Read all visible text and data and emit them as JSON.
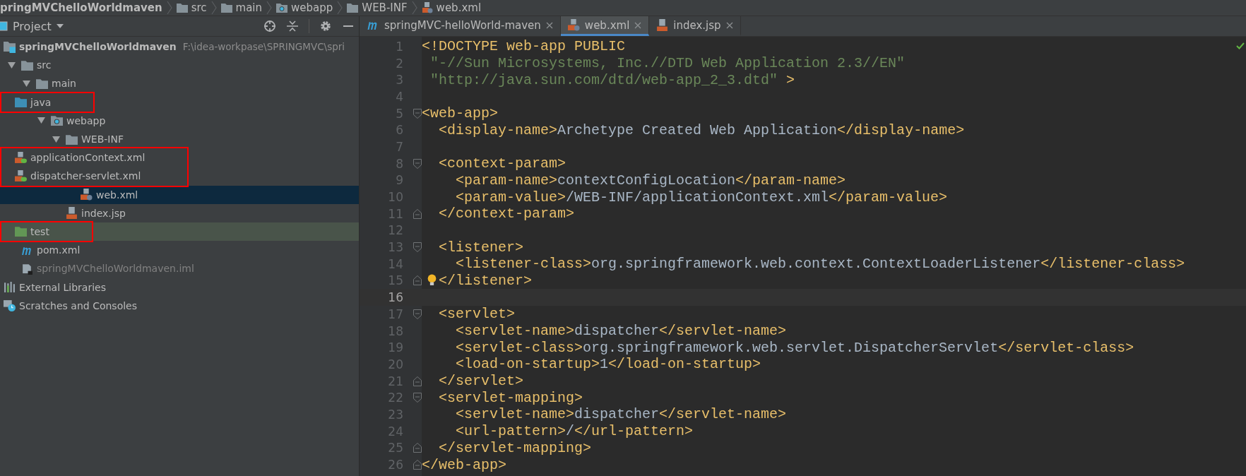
{
  "breadcrumb": [
    {
      "label": "pringMVChelloWorldmaven",
      "kind": "module"
    },
    {
      "label": "src",
      "kind": "folder"
    },
    {
      "label": "main",
      "kind": "folder"
    },
    {
      "label": "webapp",
      "kind": "web-folder"
    },
    {
      "label": "WEB-INF",
      "kind": "folder"
    },
    {
      "label": "web.xml",
      "kind": "web-xml"
    }
  ],
  "project_panel": {
    "title": "Project",
    "tree": [
      {
        "label": "springMVChelloWorldmaven",
        "path": "F:\\idea-workpase\\SPRINGMVC\\spri",
        "kind": "module",
        "selected": false,
        "children": [
          {
            "label": "src",
            "kind": "folder",
            "expanded": true,
            "selected": false,
            "children": [
              {
                "label": "main",
                "kind": "folder",
                "expanded": true,
                "selected": false,
                "children": [
                  {
                    "label": "java",
                    "kind": "source-folder",
                    "selected": false,
                    "marked": true
                  },
                  {
                    "label": "webapp",
                    "kind": "web-folder",
                    "expanded": true,
                    "selected": false,
                    "children": [
                      {
                        "label": "WEB-INF",
                        "kind": "folder",
                        "expanded": true,
                        "selected": false,
                        "children": [
                          {
                            "label": "applicationContext.xml",
                            "kind": "spring-xml",
                            "selected": false,
                            "marked": true
                          },
                          {
                            "label": "dispatcher-servlet.xml",
                            "kind": "spring-xml",
                            "selected": false,
                            "marked": true
                          },
                          {
                            "label": "web.xml",
                            "kind": "web-xml",
                            "selected": true
                          }
                        ]
                      },
                      {
                        "label": "index.jsp",
                        "kind": "jsp",
                        "selected": false
                      }
                    ]
                  }
                ]
              },
              {
                "label": "test",
                "kind": "test-folder",
                "selected": false,
                "tinted": true,
                "marked": true
              }
            ]
          },
          {
            "label": "pom.xml",
            "kind": "maven",
            "selected": false
          },
          {
            "label": "springMVChelloWorldmaven.iml",
            "kind": "iml",
            "dim": true,
            "selected": false
          }
        ]
      },
      {
        "label": "External Libraries",
        "kind": "libraries",
        "selected": false
      },
      {
        "label": "Scratches and Consoles",
        "kind": "scratches",
        "selected": false
      }
    ]
  },
  "editor": {
    "tabs": [
      {
        "label": "springMVC-helloWorld-maven",
        "kind": "maven",
        "selected": false
      },
      {
        "label": "web.xml",
        "kind": "web-xml",
        "selected": true
      },
      {
        "label": "index.jsp",
        "kind": "jsp",
        "selected": false
      }
    ],
    "lines": [
      {
        "number": "1",
        "tokens": [
          {
            "kind": "tag",
            "text": "<!DOCTYPE web-app PUBLIC"
          }
        ]
      },
      {
        "number": "2",
        "tokens": [
          {
            "kind": "string",
            "text": " \"-//Sun Microsystems, Inc.//DTD Web Application 2.3//EN\""
          }
        ]
      },
      {
        "number": "3",
        "tokens": [
          {
            "kind": "string",
            "text": " \"http://java.sun.com/dtd/web-app_2_3.dtd\""
          },
          {
            "kind": "tag",
            "text": " >"
          }
        ]
      },
      {
        "number": "4"
      },
      {
        "number": "5",
        "fold_open": true,
        "tokens": [
          {
            "kind": "tag",
            "text": "<web-app>"
          }
        ]
      },
      {
        "number": "6",
        "tokens": [
          {
            "kind": "tag",
            "text": "  <display-name>"
          },
          {
            "kind": "text",
            "text": "Archetype Created Web Application"
          },
          {
            "kind": "tag",
            "text": "</display-name>"
          }
        ]
      },
      {
        "number": "7"
      },
      {
        "number": "8",
        "fold_open": true,
        "tokens": [
          {
            "kind": "tag",
            "text": "  <context-param>"
          }
        ]
      },
      {
        "number": "9",
        "tokens": [
          {
            "kind": "tag",
            "text": "    <param-name>"
          },
          {
            "kind": "text",
            "text": "contextConfigLocation"
          },
          {
            "kind": "tag",
            "text": "</param-name>"
          }
        ]
      },
      {
        "number": "10",
        "tokens": [
          {
            "kind": "tag",
            "text": "    <param-value>"
          },
          {
            "kind": "text",
            "text": "/WEB-INF/applicationContext.xml"
          },
          {
            "kind": "tag",
            "text": "</param-value>"
          }
        ]
      },
      {
        "number": "11",
        "fold_close": true,
        "tokens": [
          {
            "kind": "tag",
            "text": "  </context-param>"
          }
        ]
      },
      {
        "number": "12"
      },
      {
        "number": "13",
        "fold_open": true,
        "tokens": [
          {
            "kind": "tag",
            "text": "  <listener>"
          }
        ]
      },
      {
        "number": "14",
        "tokens": [
          {
            "kind": "tag",
            "text": "    <listener-class>"
          },
          {
            "kind": "text",
            "text": "org.springframework.web.context.ContextLoaderListener"
          },
          {
            "kind": "tag",
            "text": "</listener-class>"
          }
        ]
      },
      {
        "number": "15",
        "fold_close": true,
        "bulb": true,
        "tokens": [
          {
            "kind": "tag",
            "text": "  </listener>"
          }
        ]
      },
      {
        "number": "16",
        "current": true
      },
      {
        "number": "17",
        "fold_open": true,
        "tokens": [
          {
            "kind": "tag",
            "text": "  <servlet>"
          }
        ]
      },
      {
        "number": "18",
        "tokens": [
          {
            "kind": "tag",
            "text": "    <servlet-name>"
          },
          {
            "kind": "text",
            "text": "dispatcher"
          },
          {
            "kind": "tag",
            "text": "</servlet-name>"
          }
        ]
      },
      {
        "number": "19",
        "tokens": [
          {
            "kind": "tag",
            "text": "    <servlet-class>"
          },
          {
            "kind": "text",
            "text": "org.springframework.web.servlet.DispatcherServlet"
          },
          {
            "kind": "tag",
            "text": "</servlet-class>"
          }
        ]
      },
      {
        "number": "20",
        "tokens": [
          {
            "kind": "tag",
            "text": "    <load-on-startup>"
          },
          {
            "kind": "text",
            "text": "1"
          },
          {
            "kind": "tag",
            "text": "</load-on-startup>"
          }
        ]
      },
      {
        "number": "21",
        "fold_close": true,
        "tokens": [
          {
            "kind": "tag",
            "text": "  </servlet>"
          }
        ]
      },
      {
        "number": "22",
        "fold_open": true,
        "tokens": [
          {
            "kind": "tag",
            "text": "  <servlet-mapping>"
          }
        ]
      },
      {
        "number": "23",
        "tokens": [
          {
            "kind": "tag",
            "text": "    <servlet-name>"
          },
          {
            "kind": "text",
            "text": "dispatcher"
          },
          {
            "kind": "tag",
            "text": "</servlet-name>"
          }
        ]
      },
      {
        "number": "24",
        "tokens": [
          {
            "kind": "tag",
            "text": "    <url-pattern>"
          },
          {
            "kind": "text",
            "text": "/"
          },
          {
            "kind": "tag",
            "text": "</url-pattern>"
          }
        ]
      },
      {
        "number": "25",
        "fold_close": true,
        "tokens": [
          {
            "kind": "tag",
            "text": "  </servlet-mapping>"
          }
        ]
      },
      {
        "number": "26",
        "fold_close": true,
        "tokens": [
          {
            "kind": "tag",
            "text": "</web-app>"
          }
        ]
      }
    ]
  }
}
